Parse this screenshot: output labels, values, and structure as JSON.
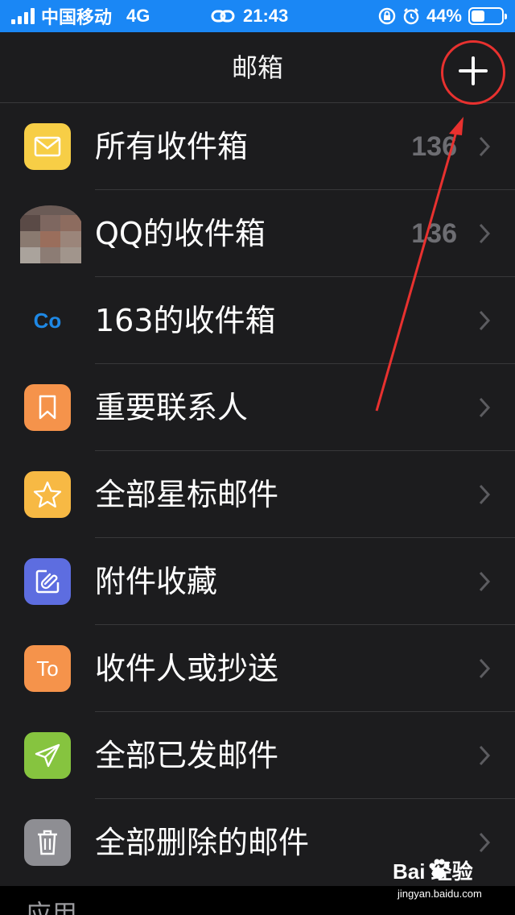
{
  "status_bar": {
    "carrier": "中国移动",
    "network": "4G",
    "time": "21:43",
    "battery_percent": "44%",
    "battery_level": 0.44,
    "signal_bars": 4
  },
  "nav": {
    "title": "邮箱",
    "add_icon": "plus-icon"
  },
  "mailboxes": [
    {
      "label": "所有收件箱",
      "count": "136",
      "icon": "envelope-icon",
      "icon_color": "#f7ce46"
    },
    {
      "label": "QQ的收件箱",
      "count": "136",
      "icon": "avatar-blurred",
      "icon_color": ""
    },
    {
      "label": "163的收件箱",
      "count": "",
      "icon_text": "Co",
      "icon": "co-text-icon",
      "icon_color": "#1e88e5"
    },
    {
      "label": "重要联系人",
      "count": "",
      "icon": "bookmark-icon",
      "icon_color": "#f5934b"
    },
    {
      "label": "全部星标邮件",
      "count": "",
      "icon": "star-icon",
      "icon_color": "#f7b944"
    },
    {
      "label": "附件收藏",
      "count": "",
      "icon": "attachment-icon",
      "icon_color": "#5d6de0"
    },
    {
      "label": "收件人或抄送",
      "count": "",
      "icon_text": "To",
      "icon": "to-text-icon",
      "icon_color": "#f5934b"
    },
    {
      "label": "全部已发邮件",
      "count": "",
      "icon": "paper-plane-icon",
      "icon_color": "#86c43f"
    },
    {
      "label": "全部删除的邮件",
      "count": "",
      "icon": "trash-icon",
      "icon_color": "#8e8e93"
    }
  ],
  "section": {
    "label": "应用"
  },
  "watermark": {
    "brand": "Bai 经验",
    "url": "jingyan.baidu.com"
  }
}
